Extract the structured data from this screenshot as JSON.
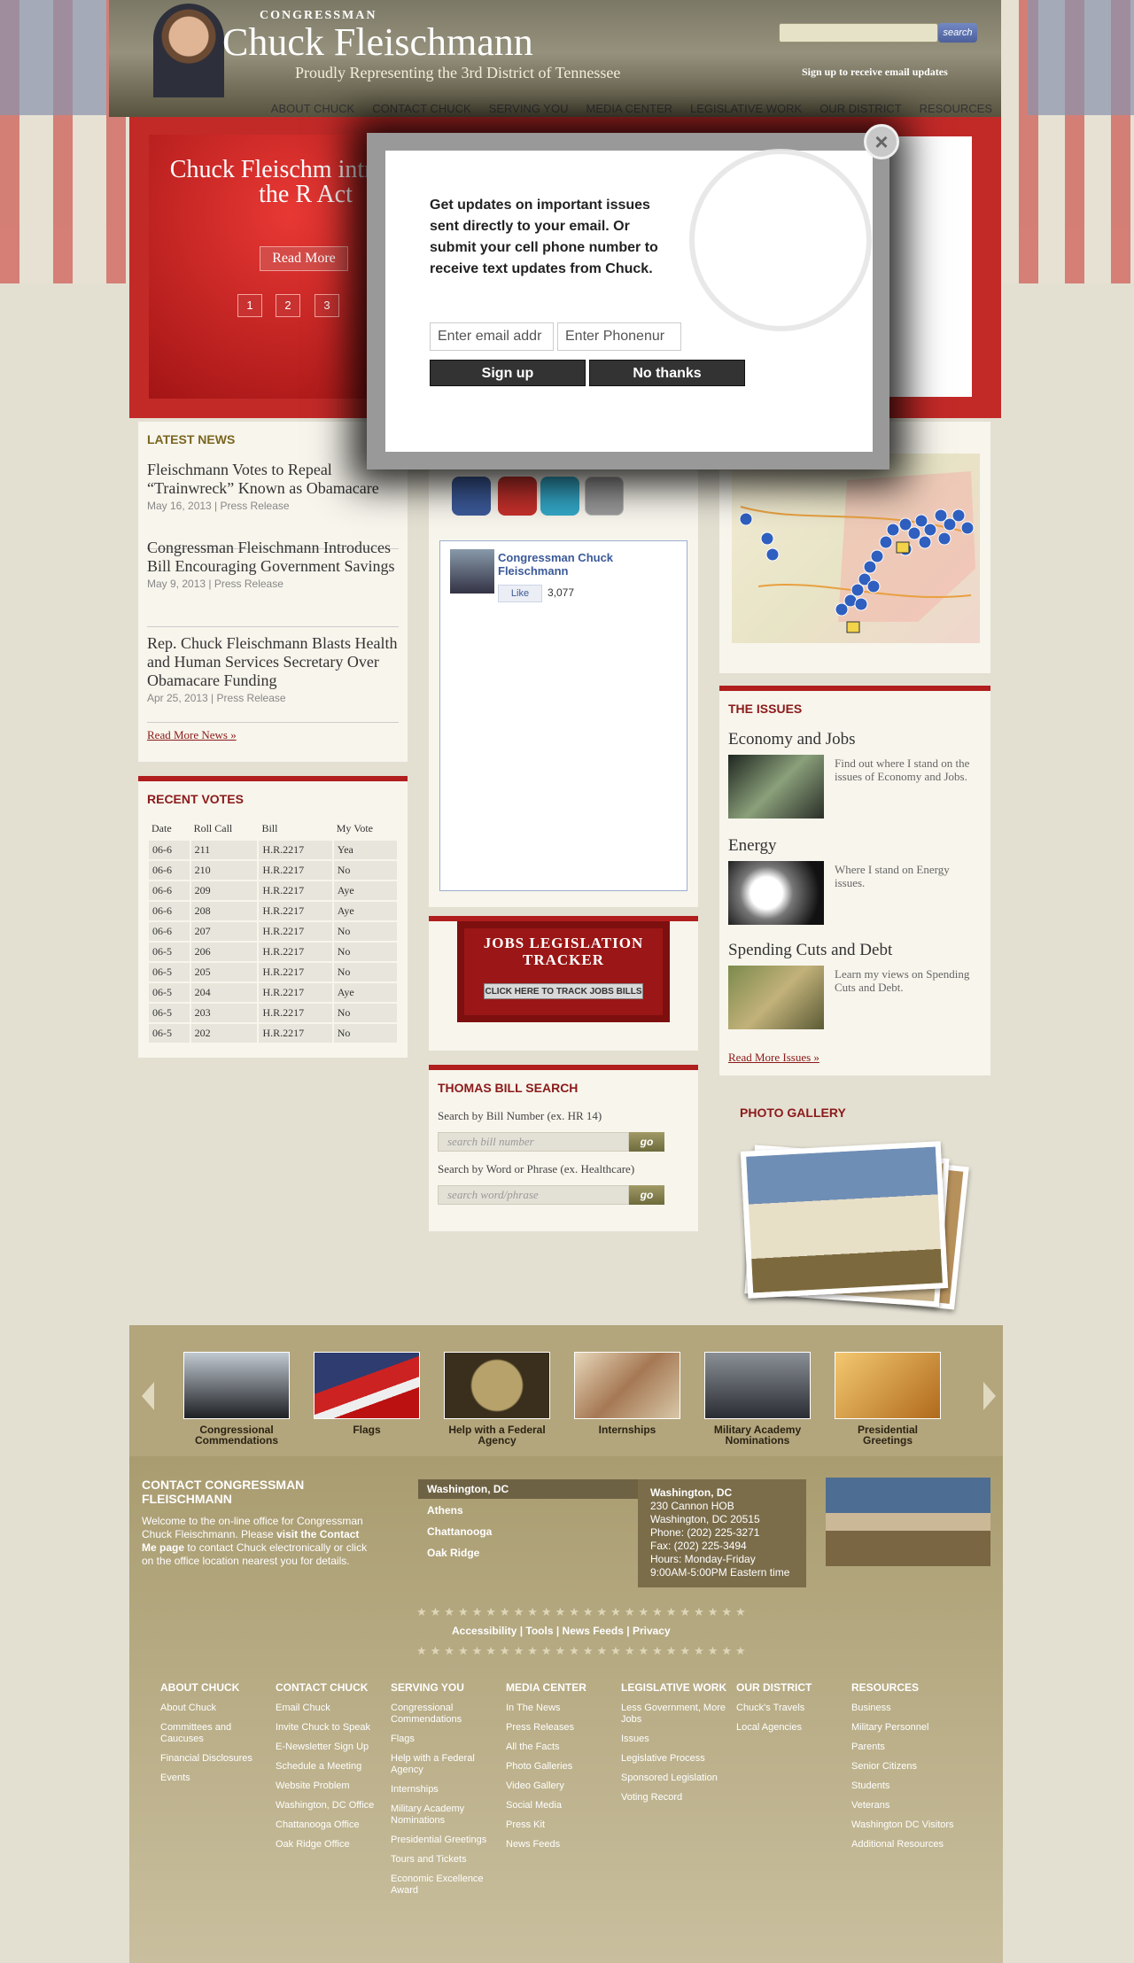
{
  "header": {
    "congressman": "CONGRESSMAN",
    "name": "Chuck Fleischmann",
    "tagline": "Proudly Representing the 3rd District of Tennessee",
    "search_label": "search",
    "signup_link": "Sign up to receive email updates"
  },
  "nav": [
    "ABOUT CHUCK",
    "CONTACT CHUCK",
    "SERVING YOU",
    "MEDIA CENTER",
    "LEGISLATIVE WORK",
    "OUR DISTRICT",
    "RESOURCES"
  ],
  "slider": {
    "title": "Chuck Fleischm introduces the R Act",
    "read_more": "Read More",
    "pages": [
      "1",
      "2",
      "3"
    ]
  },
  "latest_news": {
    "title": "LATEST NEWS",
    "items": [
      {
        "headline": "Fleischmann Votes to Repeal “Trainwreck” Known as Obamacare",
        "date": "May 16, 2013",
        "type": "Press Release"
      },
      {
        "headline": "Congressman Fleischmann Introduces Bill Encouraging Government Savings",
        "date": "May 9, 2013",
        "type": "Press Release"
      },
      {
        "headline": "Rep. Chuck Fleischmann Blasts Health and Human Services Secretary Over Obamacare Funding",
        "date": "Apr 25, 2013",
        "type": "Press Release"
      }
    ],
    "more": "Read More News »"
  },
  "recent_votes": {
    "title": "RECENT VOTES",
    "columns": [
      "Date",
      "Roll Call",
      "Bill",
      "My Vote"
    ],
    "rows": [
      [
        "06-6",
        "211",
        "H.R.2217",
        "Yea"
      ],
      [
        "06-6",
        "210",
        "H.R.2217",
        "No"
      ],
      [
        "06-6",
        "209",
        "H.R.2217",
        "Aye"
      ],
      [
        "06-6",
        "208",
        "H.R.2217",
        "Aye"
      ],
      [
        "06-6",
        "207",
        "H.R.2217",
        "No"
      ],
      [
        "06-5",
        "206",
        "H.R.2217",
        "No"
      ],
      [
        "06-5",
        "205",
        "H.R.2217",
        "No"
      ],
      [
        "06-5",
        "204",
        "H.R.2217",
        "Aye"
      ],
      [
        "06-5",
        "203",
        "H.R.2217",
        "No"
      ],
      [
        "06-5",
        "202",
        "H.R.2217",
        "No"
      ]
    ]
  },
  "facebook": {
    "name": "Congressman Chuck Fleischmann",
    "like": "Like",
    "count": "3,077"
  },
  "jobs": {
    "title": "JOBS LEGISLATION TRACKER",
    "button": "CLICK HERE TO TRACK JOBS BILLS"
  },
  "thomas": {
    "title": "THOMAS BILL SEARCH",
    "label1": "Search by Bill Number (ex. HR 14)",
    "placeholder1": "search bill number",
    "label2": "Search by Word or Phrase (ex. Healthcare)",
    "placeholder2": "search word/phrase",
    "go": "go"
  },
  "issues": {
    "title": "THE ISSUES",
    "items": [
      {
        "name": "Economy and Jobs",
        "text": "Find out where I stand on the issues of Economy and Jobs."
      },
      {
        "name": "Energy",
        "text": "Where I stand on Energy issues."
      },
      {
        "name": "Spending Cuts and Debt",
        "text": "Learn my views on Spending Cuts and Debt."
      }
    ],
    "more": "Read More Issues »"
  },
  "photo_gallery": {
    "title": "PHOTO GALLERY"
  },
  "strip": [
    "Congressional Commendations",
    "Flags",
    "Help with a Federal Agency",
    "Internships",
    "Military Academy Nominations",
    "Presidential Greetings"
  ],
  "contact": {
    "title": "CONTACT CONGRESSMAN FLEISCHMANN",
    "body_pre": "Welcome to the on-line office for Congressman Chuck Fleischmann. Please ",
    "body_link": "visit the Contact Me page",
    "body_post": " to contact Chuck electronically or click on the office location nearest you for details.",
    "offices": [
      "Washington, DC",
      "Athens",
      "Chattanooga",
      "Oak Ridge"
    ],
    "info": [
      "Washington, DC",
      "230 Cannon HOB",
      "Washington, DC 20515",
      "Phone: (202) 225-3271",
      "Fax: (202) 225-3494",
      "Hours: Monday-Friday",
      "9:00AM-5:00PM Eastern time"
    ]
  },
  "footer_links": [
    "Accessibility",
    "Tools",
    "News Feeds",
    "Privacy"
  ],
  "footer_cols": [
    {
      "title": "ABOUT CHUCK",
      "items": [
        "About Chuck",
        "Committees and Caucuses",
        "Financial Disclosures",
        "Events"
      ]
    },
    {
      "title": "CONTACT CHUCK",
      "items": [
        "Email Chuck",
        "Invite Chuck to Speak",
        "E-Newsletter Sign Up",
        "Schedule a Meeting",
        "Website Problem",
        "Washington, DC Office",
        "Chattanooga Office",
        "Oak Ridge Office"
      ]
    },
    {
      "title": "SERVING YOU",
      "items": [
        "Congressional Commendations",
        "Flags",
        "Help with a Federal Agency",
        "Internships",
        "Military Academy Nominations",
        "Presidential Greetings",
        "Tours and Tickets",
        "Economic Excellence Award"
      ]
    },
    {
      "title": "MEDIA CENTER",
      "items": [
        "In The News",
        "Press Releases",
        "All the Facts",
        "Photo Galleries",
        "Video Gallery",
        "Social Media",
        "Press Kit",
        "News Feeds"
      ]
    },
    {
      "title": "LEGISLATIVE WORK",
      "items": [
        "Less Government, More Jobs",
        "Issues",
        "Legislative Process",
        "Sponsored Legislation",
        "Voting Record"
      ]
    },
    {
      "title": "OUR DISTRICT",
      "items": [
        "Chuck's Travels",
        "Local Agencies"
      ]
    },
    {
      "title": "RESOURCES",
      "items": [
        "Business",
        "Military Personnel",
        "Parents",
        "Senior Citizens",
        "Students",
        "Veterans",
        "Washington DC Visitors",
        "Additional Resources"
      ]
    }
  ],
  "modal": {
    "text": "Get updates on important issues sent directly to your email. Or submit your cell phone number to receive text updates from Chuck.",
    "email_placeholder": "Enter email addr",
    "phone_placeholder": "Enter Phonenur",
    "signup": "Sign up",
    "nothanks": "No thanks",
    "close": "×"
  }
}
